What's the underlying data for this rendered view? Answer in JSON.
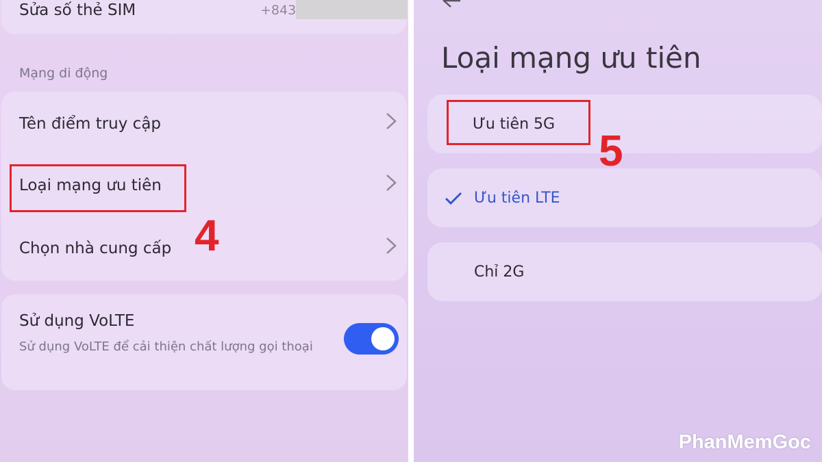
{
  "left": {
    "sim_row_label": "Sửa số thẻ SIM",
    "sim_number": "+843",
    "section_label": "Mạng di động",
    "items": [
      {
        "label": "Tên điểm truy cập"
      },
      {
        "label": "Loại mạng ưu tiên"
      },
      {
        "label": "Chọn nhà cung cấp"
      }
    ],
    "volte": {
      "title": "Sử dụng VoLTE",
      "description": "Sử dụng VoLTE để cải thiện chất lượng gọi thoại",
      "enabled": true
    },
    "step_number": "4"
  },
  "right": {
    "title": "Loại mạng ưu tiên",
    "options": [
      {
        "label": "Ưu tiên 5G",
        "selected": false
      },
      {
        "label": "Ưu tiên LTE",
        "selected": true
      },
      {
        "label": "Chỉ 2G",
        "selected": false
      }
    ],
    "step_number": "5"
  },
  "colors": {
    "highlight": "#e2242a",
    "toggle_on": "#2f5ef0",
    "selected_text": "#3656c8"
  },
  "watermark": "PhanMemGoc"
}
